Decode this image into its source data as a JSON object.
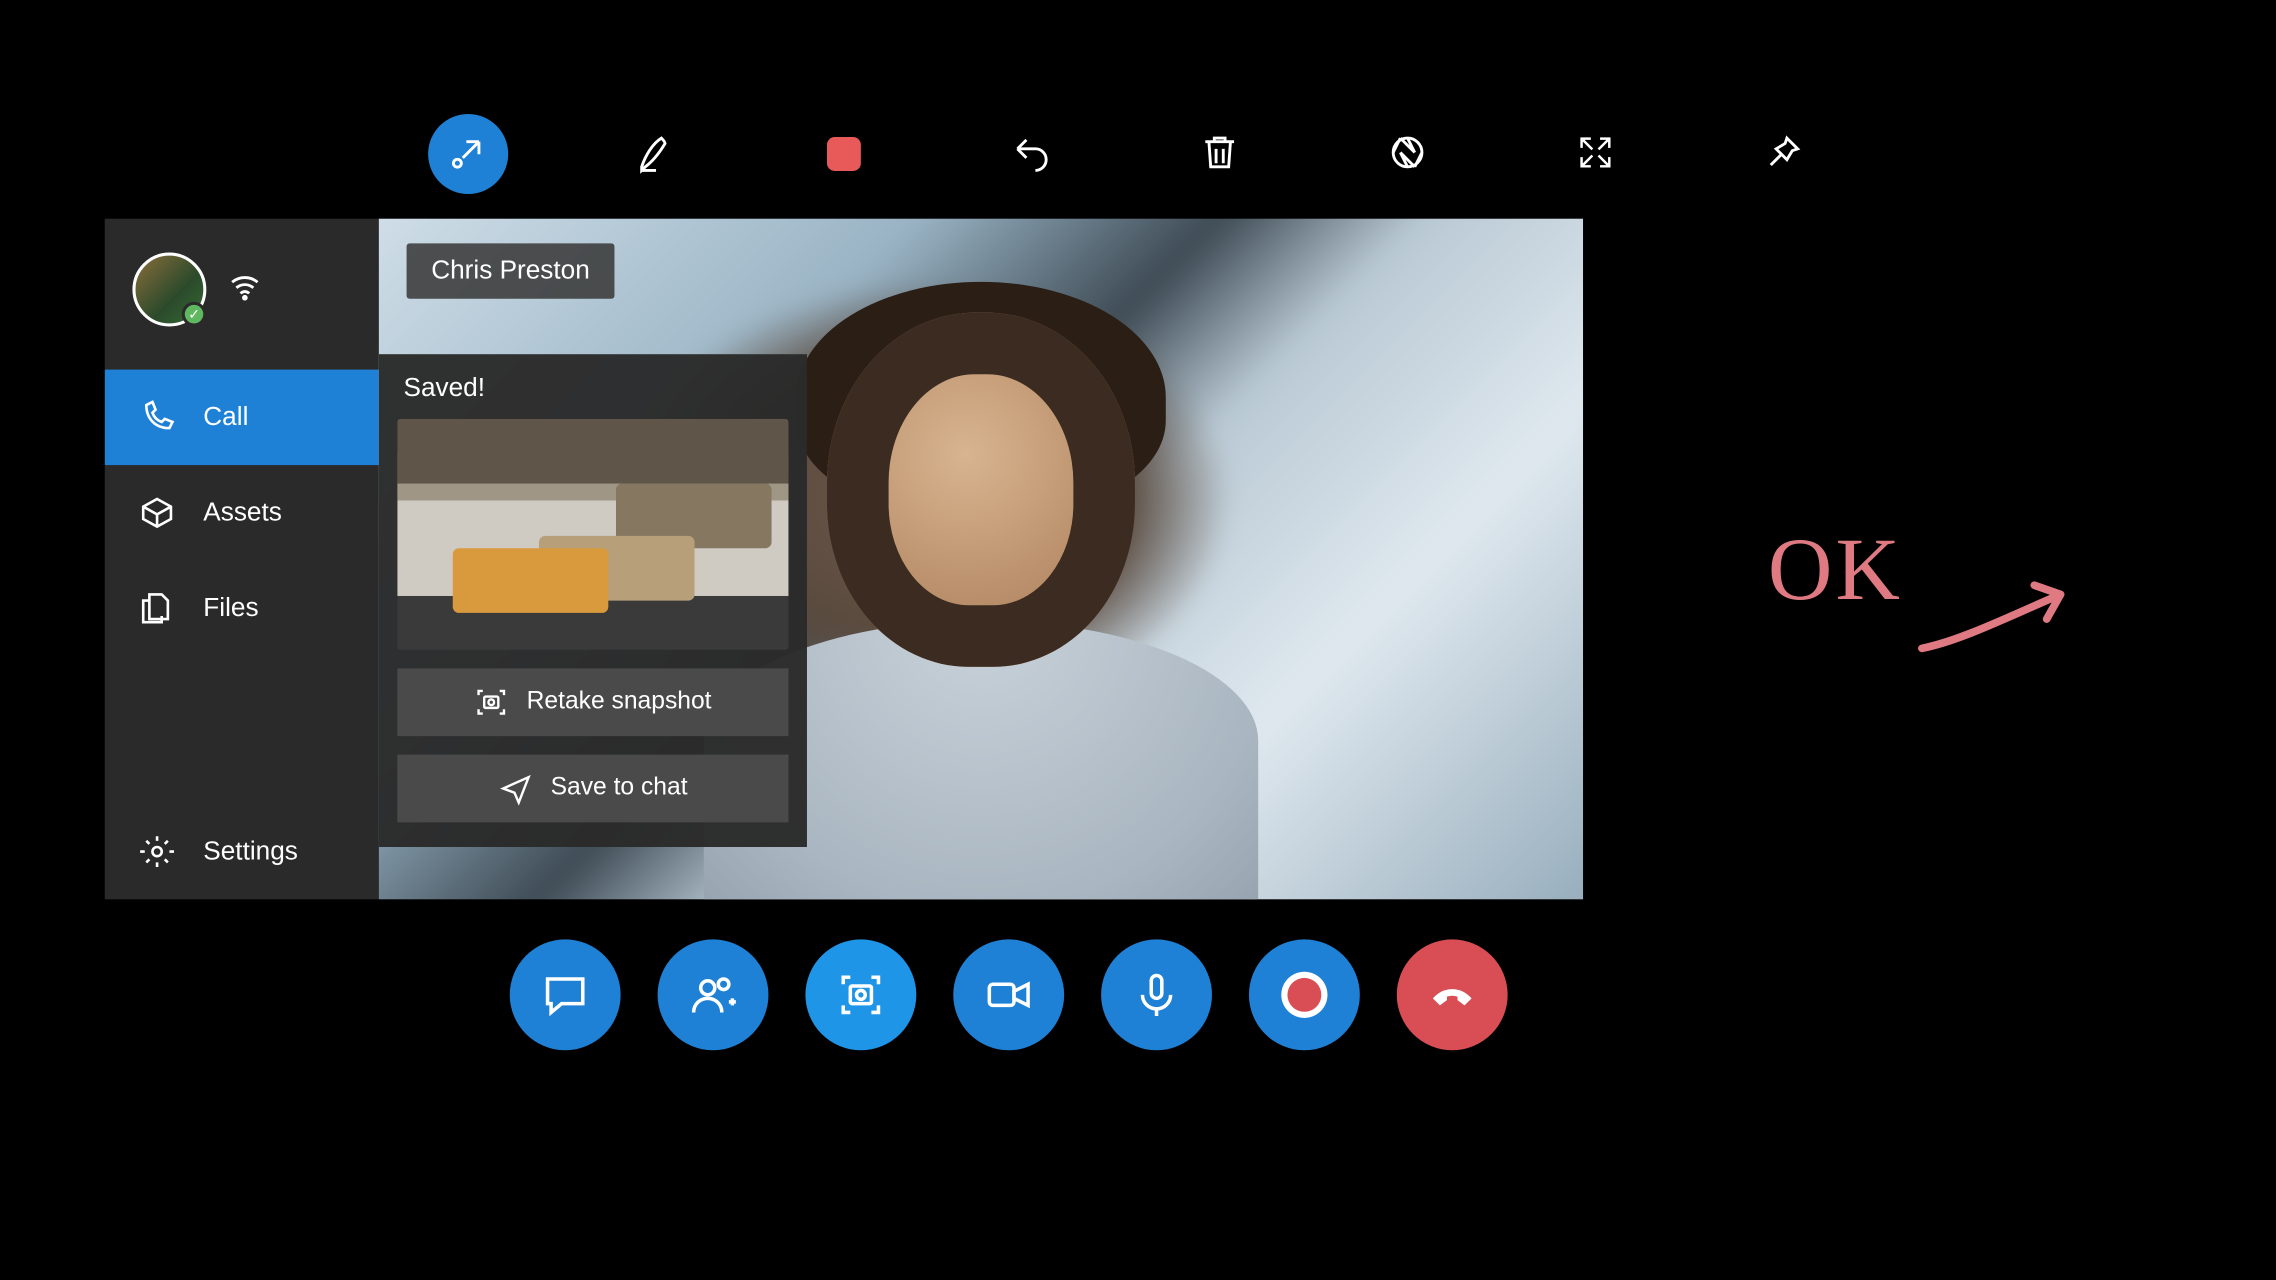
{
  "toolbar": {
    "items": [
      {
        "name": "collapse-icon"
      },
      {
        "name": "pen-icon"
      },
      {
        "name": "stop-icon"
      },
      {
        "name": "undo-icon"
      },
      {
        "name": "trash-icon"
      },
      {
        "name": "aperture-icon"
      },
      {
        "name": "fullscreen-icon"
      },
      {
        "name": "pin-icon"
      }
    ]
  },
  "sidebar": {
    "items": [
      {
        "name": "sidebar-item-call",
        "label": "Call"
      },
      {
        "name": "sidebar-item-assets",
        "label": "Assets"
      },
      {
        "name": "sidebar-item-files",
        "label": "Files"
      },
      {
        "name": "sidebar-item-settings",
        "label": "Settings"
      }
    ]
  },
  "video": {
    "participant_name": "Chris Preston"
  },
  "snapshot_popup": {
    "title": "Saved!",
    "retake_label": "Retake snapshot",
    "save_label": "Save to chat"
  },
  "call_controls": {
    "chat_label": "Chat",
    "add_label": "Add participant",
    "snapshot_label": "Snapshot",
    "video_label": "Video",
    "mic_label": "Microphone",
    "record_label": "Record",
    "hangup_label": "Hang up"
  },
  "annotation": {
    "text": "OK"
  },
  "colors": {
    "brand_blue": "#1f81d6",
    "brand_blue_light": "#1f95e8",
    "danger_red": "#d94e55",
    "ink_pink": "#e07a82"
  }
}
